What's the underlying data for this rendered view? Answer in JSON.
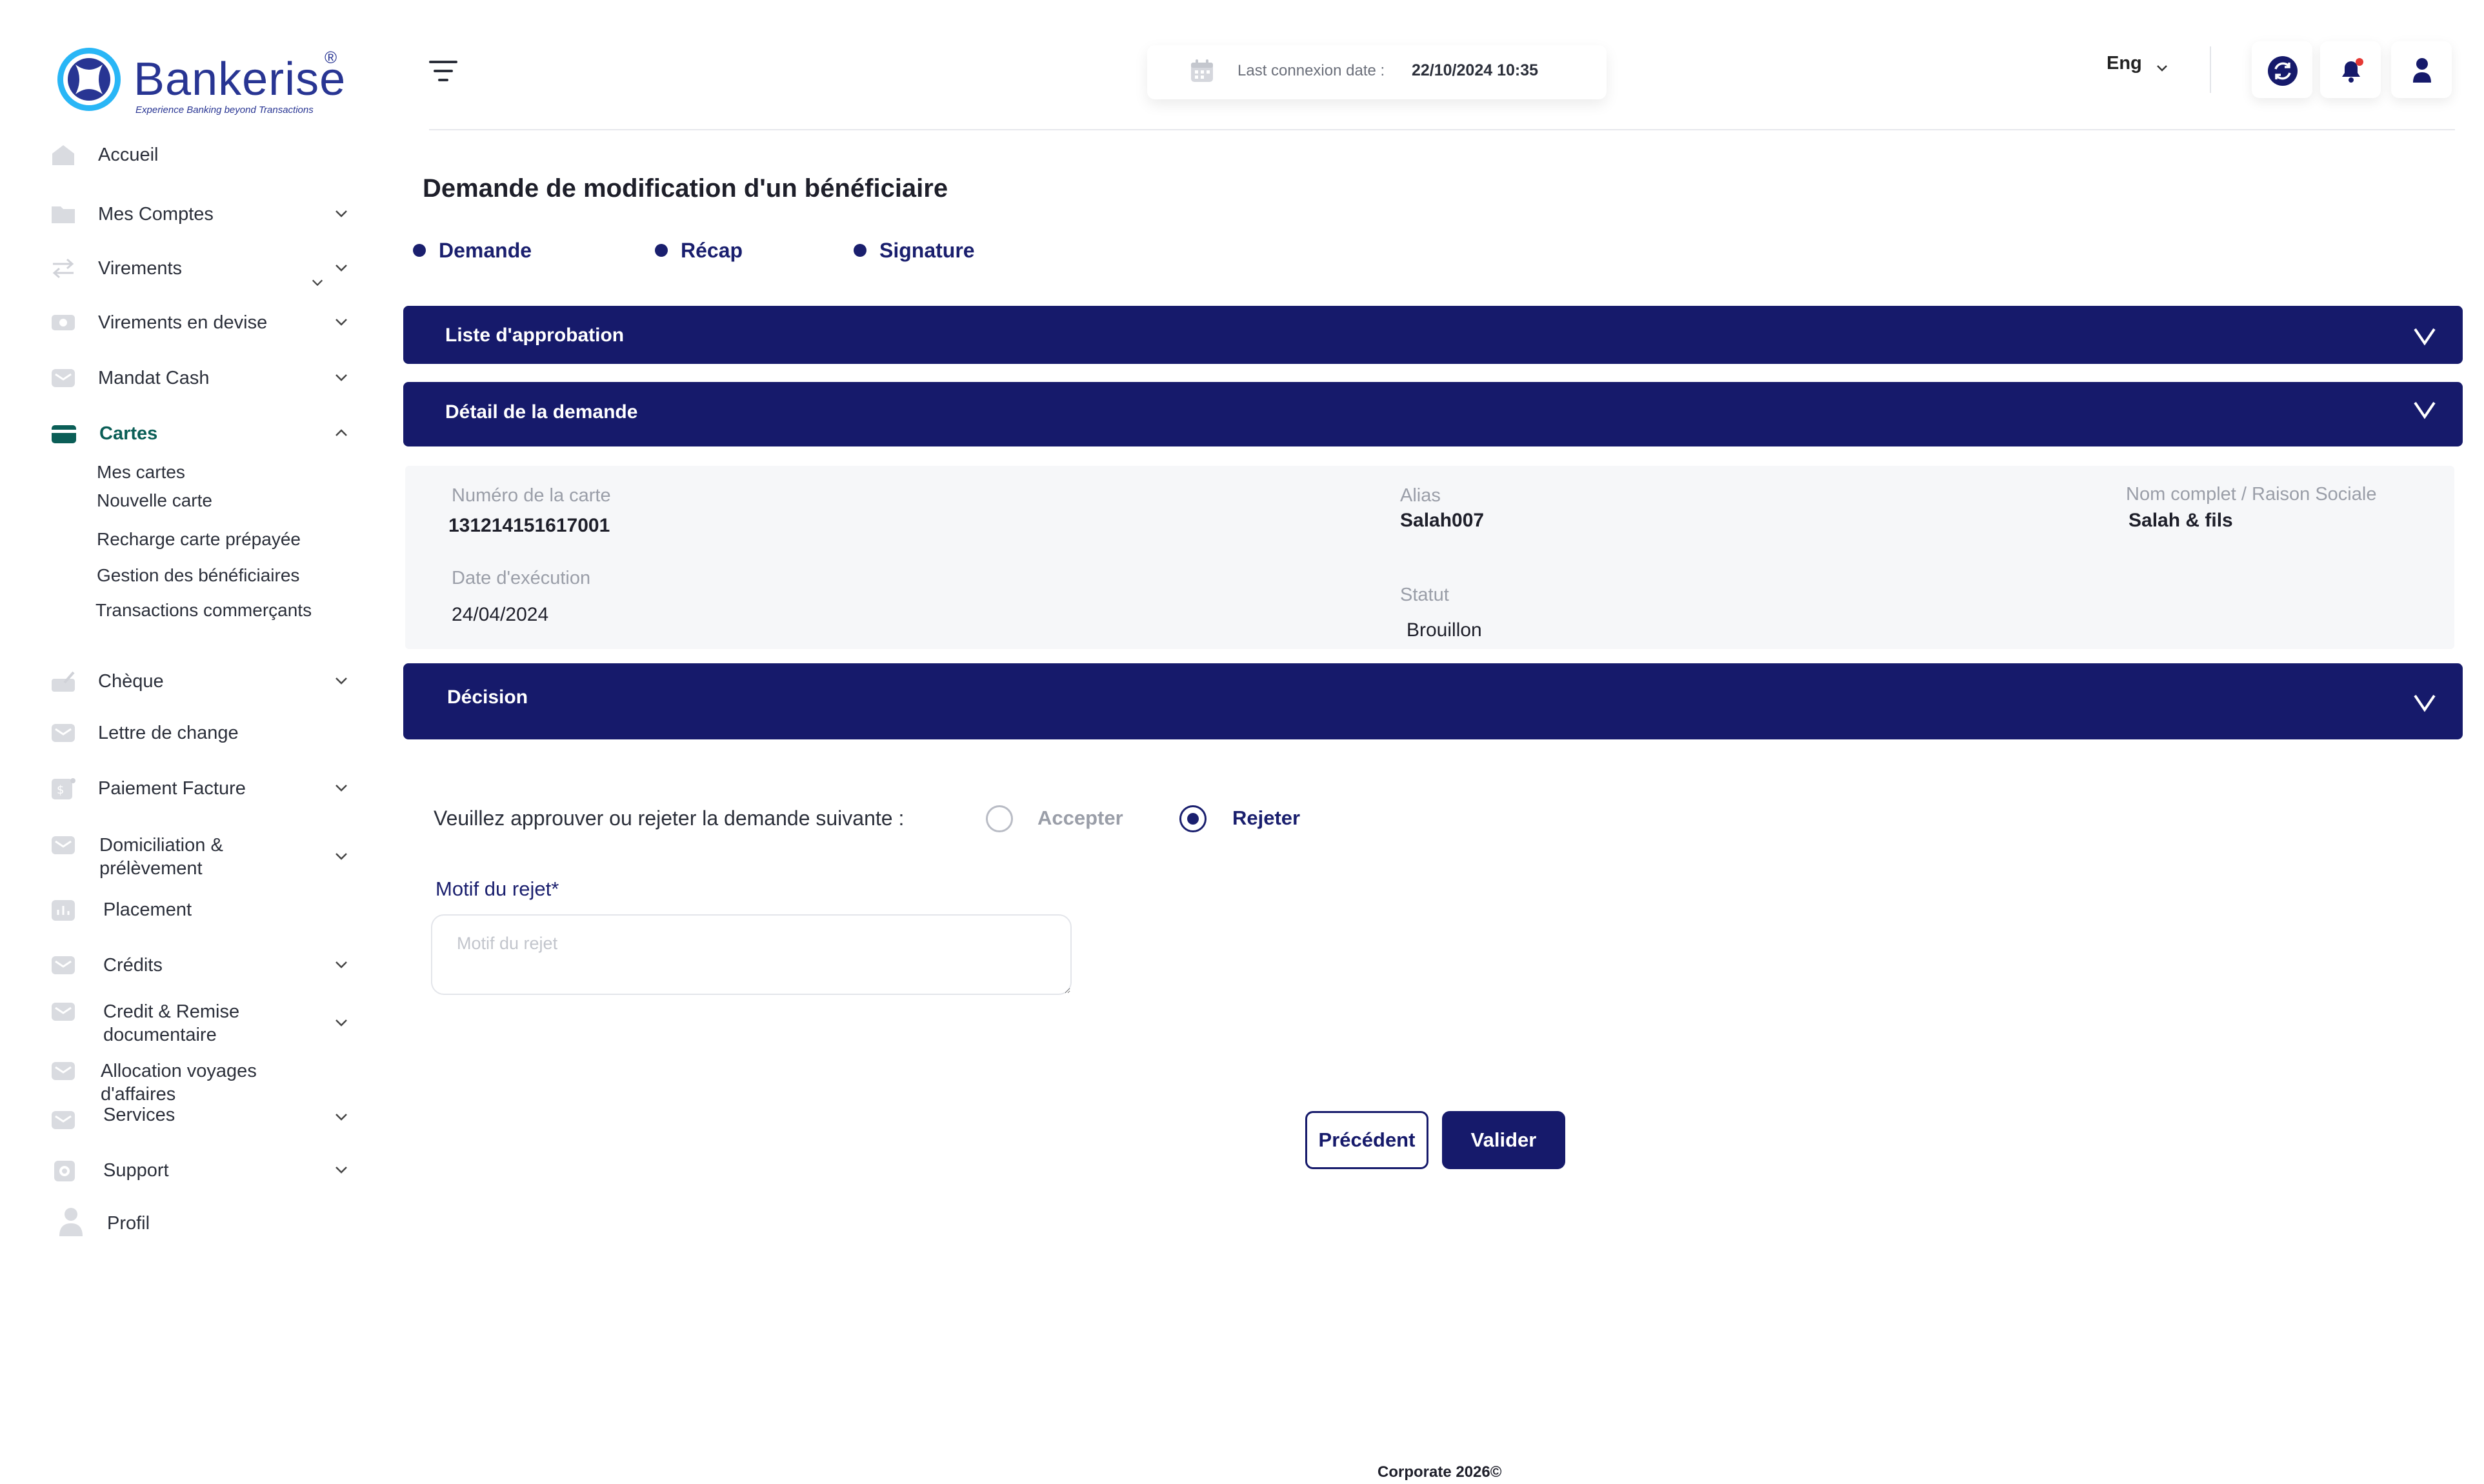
{
  "brand": {
    "name": "Bankerise",
    "registered": "®",
    "tagline": "Experience Banking beyond Transactions",
    "color_primary": "#283593",
    "color_accent": "#29b6f6"
  },
  "colors": {
    "navy": "#161a6b",
    "active_green": "#0b5e57",
    "notification_dot": "#e53935"
  },
  "sidebar": {
    "items": [
      {
        "label": "Accueil",
        "icon": "home-icon"
      },
      {
        "label": "Mes Comptes",
        "icon": "folder-icon"
      },
      {
        "label": "Virements",
        "icon": "transfer-arrows-icon"
      },
      {
        "label": "Virements en devise",
        "icon": "currency-icon"
      },
      {
        "label": "Mandat Cash",
        "icon": "envelope-icon"
      },
      {
        "label": "Cartes",
        "icon": "card-icon"
      },
      {
        "label": "Chèque",
        "icon": "cheque-icon"
      },
      {
        "label": "Lettre de change",
        "icon": "envelope-icon"
      },
      {
        "label": "Paiement Facture",
        "icon": "invoice-icon"
      },
      {
        "label": "Domiciliation &",
        "label_line2": "prélèvement",
        "icon": "envelope-icon"
      },
      {
        "label": "Placement",
        "icon": "chart-icon"
      },
      {
        "label": "Crédits",
        "icon": "envelope-icon"
      },
      {
        "label": "Credit & Remise",
        "label_line2": "documentaire",
        "icon": "envelope-icon"
      },
      {
        "label": "Allocation  voyages",
        "label_line2": "d'affaires",
        "icon": "envelope-icon"
      },
      {
        "label": "Services",
        "icon": "envelope-icon"
      },
      {
        "label": "Support",
        "icon": "support-icon"
      },
      {
        "label": "Profil",
        "icon": "user-icon"
      }
    ],
    "cartes_sub": [
      "Mes cartes",
      "Nouvelle carte",
      "Recharge carte prépayée",
      "Gestion des bénéficiaires",
      "Transactions commerçants"
    ]
  },
  "header": {
    "last_connexion_label": "Last connexion date :",
    "last_connexion_value": "22/10/2024 10:35",
    "language": "Eng"
  },
  "main": {
    "title": "Demande de modification  d'un bénéficiaire",
    "steps": [
      "Demande",
      "Récap",
      "Signature"
    ],
    "accordions": {
      "approval": "Liste d'approbation",
      "detail": "Détail de la demande",
      "decision": "Décision"
    },
    "detail": {
      "card_number_label": "Numéro de la carte",
      "card_number": "131214151617001",
      "alias_label": "Alias",
      "alias": "Salah007",
      "fullname_label": "Nom complet / Raison Sociale",
      "fullname": "Salah & fils",
      "exec_date_label": "Date d'exécution",
      "exec_date": "24/04/2024",
      "status_label": "Statut",
      "status": "Brouillon"
    },
    "decision": {
      "question": "Veuillez approuver ou rejeter la demande suivante :",
      "accept_label": "Accepter",
      "reject_label": "Rejeter",
      "selected": "Rejeter",
      "motif_label": "Motif du rejet*",
      "motif_placeholder": "Motif du rejet",
      "motif_value": ""
    },
    "buttons": {
      "previous": "Précédent",
      "validate": "Valider"
    }
  },
  "footer": {
    "text": "Corporate 2026©"
  }
}
